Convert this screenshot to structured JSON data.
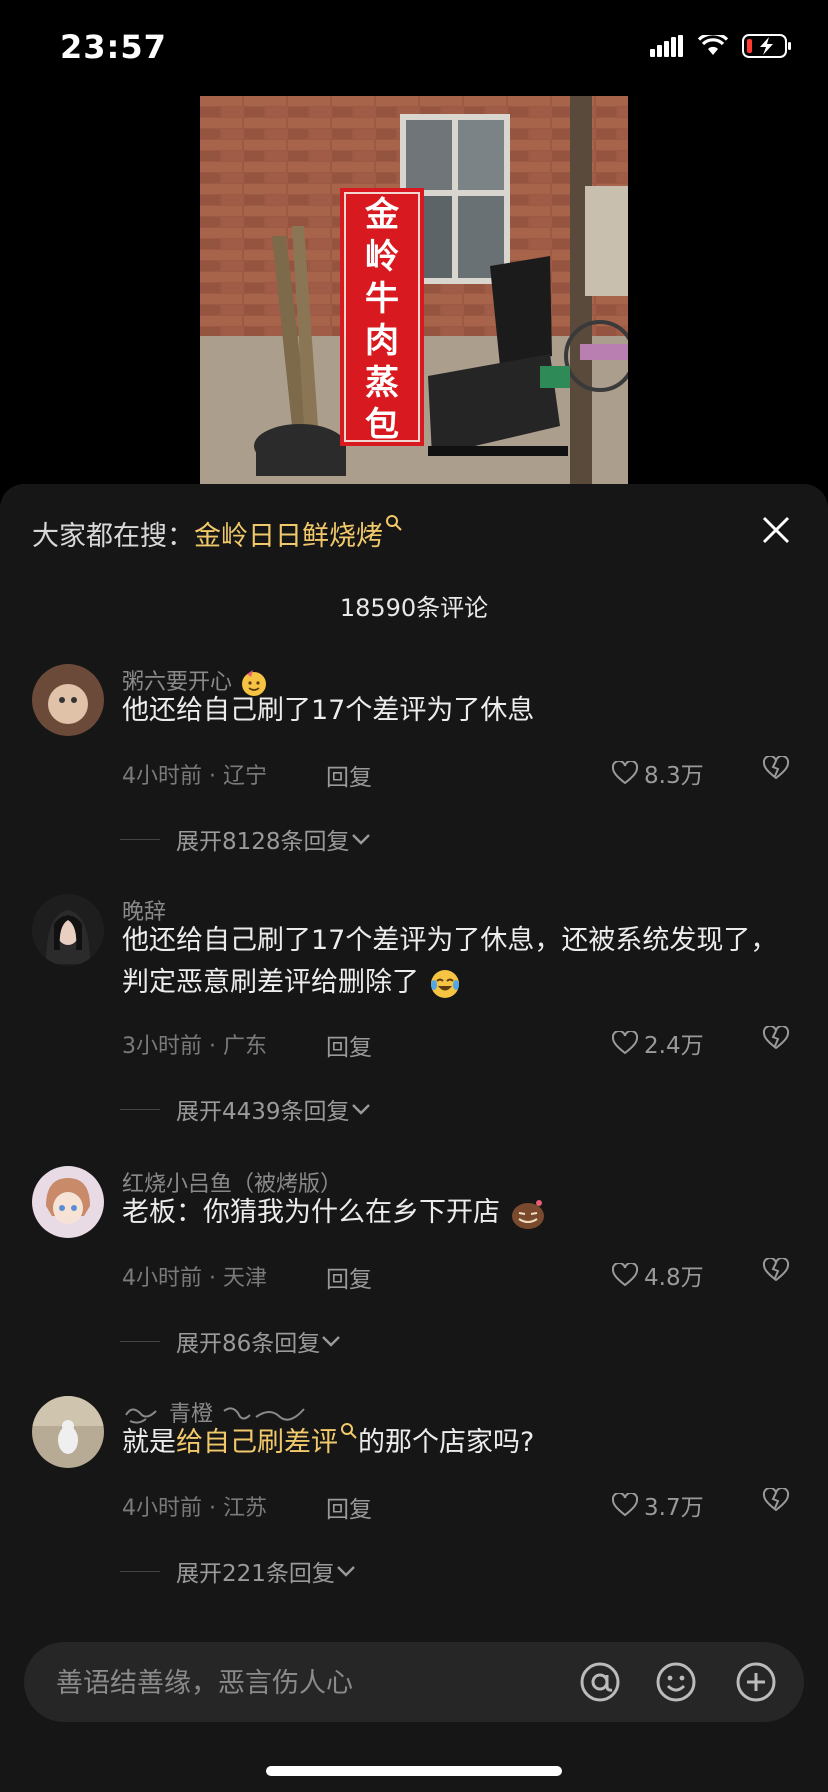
{
  "status": {
    "time": "23:57"
  },
  "video": {
    "sign_text": [
      "金",
      "岭",
      "牛",
      "肉",
      "蒸",
      "包"
    ]
  },
  "sheet": {
    "search_prefix": "大家都在搜：",
    "search_term": "金岭日日鲜烧烤",
    "comment_count": "18590条评论",
    "icons": [
      "magnifier-icon",
      "close-icon"
    ]
  },
  "comments": [
    {
      "user": "粥六要开心",
      "text": "他还给自己刷了17个差评为了休息",
      "meta": "4小时前 · 辽宁",
      "reply": "回复",
      "likes": "8.3万",
      "expand": "展开8128条回复"
    },
    {
      "user": "晚辞",
      "text": "他还给自己刷了17个差评为了休息，还被系统发现了，判定恶意刷差评给删除了",
      "meta": "3小时前 · 广东",
      "reply": "回复",
      "likes": "2.4万",
      "expand": "展开4439条回复"
    },
    {
      "user": "红烧小吕鱼（被烤版）",
      "text": "老板：你猜我为什么在乡下开店",
      "meta": "4小时前 · 天津",
      "reply": "回复",
      "likes": "4.8万",
      "expand": "展开86条回复"
    },
    {
      "user": "青橙",
      "text_pre": "就是",
      "text_link": "给自己刷差评",
      "text_post": "的那个店家吗?",
      "meta": "4小时前 · 江苏",
      "reply": "回复",
      "likes": "3.7万",
      "expand": "展开221条回复"
    }
  ],
  "input": {
    "placeholder": "善语结善缘，恶言伤人心",
    "icons": [
      "at-icon",
      "emoji-icon",
      "plus-icon"
    ]
  },
  "colors": {
    "accent": "#f1c96a",
    "sheet_bg": "#161616",
    "input_bg": "#262626"
  }
}
